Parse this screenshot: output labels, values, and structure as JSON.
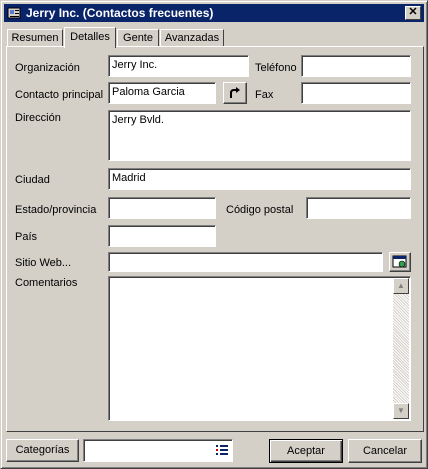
{
  "window": {
    "title": "Jerry Inc. (Contactos frecuentes)",
    "icon": "contact-card-icon"
  },
  "tabs": [
    {
      "label": "Resumen",
      "active": false
    },
    {
      "label": "Detalles",
      "active": true
    },
    {
      "label": "Gente",
      "active": false
    },
    {
      "label": "Avanzadas",
      "active": false
    }
  ],
  "form": {
    "organization_label": "Organización",
    "organization_value": "Jerry Inc.",
    "phone_label": "Teléfono",
    "phone_value": "",
    "contact_label": "Contacto principal",
    "contact_value": "Paloma Garcia",
    "fax_label": "Fax",
    "fax_value": "",
    "address_label": "Dirección",
    "address_value": "Jerry Bvld.",
    "city_label": "Ciudad",
    "city_value": "Madrid",
    "state_label": "Estado/provincia",
    "state_value": "",
    "zip_label": "Código postal",
    "zip_value": "",
    "country_label": "País",
    "country_value": "",
    "website_label": "Sitio Web...",
    "website_value": "",
    "comments_label": "Comentarios",
    "comments_value": ""
  },
  "footer": {
    "categories_label": "Categorías",
    "categories_value": "",
    "accept_label": "Aceptar",
    "cancel_label": "Cancelar"
  }
}
